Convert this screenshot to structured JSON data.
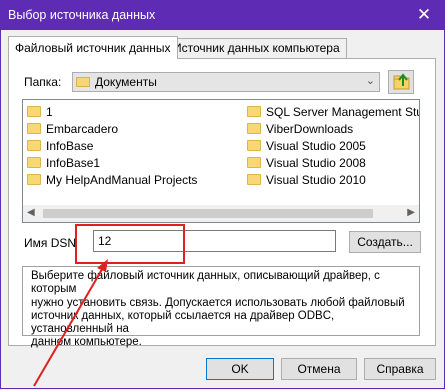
{
  "window": {
    "title": "Выбор источника данных",
    "close_glyph": "✕"
  },
  "tabs": [
    {
      "label": "Файловый источник данных",
      "active": true
    },
    {
      "label": "Источник данных компьютера",
      "active": false
    }
  ],
  "folder_picker": {
    "label": "Папка:",
    "value": "Документы",
    "arrow": "⌄"
  },
  "files": {
    "left": [
      "1",
      "Embarcadero",
      "InfoBase",
      "InfoBase1",
      "My HelpAndManual Projects"
    ],
    "right": [
      "SQL Server Management Studio E",
      "ViberDownloads",
      "Visual Studio 2005",
      "Visual Studio 2008",
      "Visual Studio 2010"
    ]
  },
  "scroll": {
    "left_arrow": "◀",
    "right_arrow": "▶"
  },
  "dsn": {
    "label": "Имя DSN",
    "value": "12"
  },
  "buttons": {
    "create": "Создать...",
    "ok": "OK",
    "cancel": "Отмена",
    "help": "Справка"
  },
  "description": {
    "lines": [
      "Выберите файловый источник данных, описывающий драйвер, с которым",
      "нужно установить связь.  Допускается использовать любой файловый",
      "источник данных, который ссылается на драйвер ODBC, установленный на",
      "данном компьютере."
    ]
  },
  "annotation": {
    "color": "#e02020"
  }
}
